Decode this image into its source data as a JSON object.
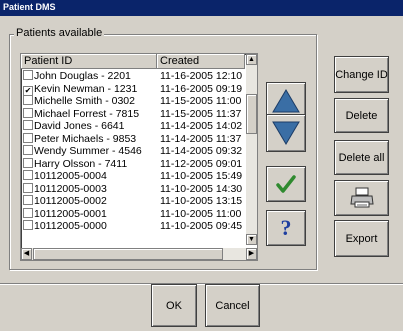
{
  "window": {
    "title": "Patient DMS"
  },
  "group": {
    "label": "Patients available"
  },
  "table": {
    "columns": [
      "Patient ID",
      "Created"
    ],
    "rows": [
      {
        "name": "John Douglas - 2201",
        "created": "11-16-2005 12:10",
        "checked": false
      },
      {
        "name": "Kevin Newman - 1231",
        "created": "11-16-2005 09:19",
        "checked": true
      },
      {
        "name": "Michelle Smith - 0302",
        "created": "11-15-2005 11:00",
        "checked": false
      },
      {
        "name": "Michael Forrest - 7815",
        "created": "11-15-2005 11:37",
        "checked": false
      },
      {
        "name": "David Jones - 6641",
        "created": "11-14-2005 14:02",
        "checked": false
      },
      {
        "name": "Peter Michaels - 9853",
        "created": "11-14-2005 11:37",
        "checked": false
      },
      {
        "name": "Wendy Summer - 4546",
        "created": "11-14-2005 09:32",
        "checked": false
      },
      {
        "name": "Harry Olsson - 7411",
        "created": "11-12-2005 09:01",
        "checked": false
      },
      {
        "name": "10112005-0004",
        "created": "11-10-2005 15:49",
        "checked": false
      },
      {
        "name": "10112005-0003",
        "created": "11-10-2005 14:30",
        "checked": false
      },
      {
        "name": "10112005-0002",
        "created": "11-10-2005 13:15",
        "checked": false
      },
      {
        "name": "10112005-0001",
        "created": "11-10-2005 11:00",
        "checked": false
      },
      {
        "name": "10112005-0000",
        "created": "11-10-2005 09:45",
        "checked": false
      }
    ]
  },
  "icons": {
    "up": "up-triangle-icon",
    "down": "down-triangle-icon",
    "check": "checkmark-icon",
    "help": "question-mark-icon",
    "printer": "printer-icon"
  },
  "buttons": {
    "change_id": "Change ID",
    "delete": "Delete",
    "delete_all": "Delete all",
    "export": "Export",
    "ok": "OK",
    "cancel": "Cancel"
  },
  "colors": {
    "titlebar": "#0a246a",
    "arrow": "#3a6ea5",
    "check": "#2f8a2f",
    "help": "#1f3fa0"
  }
}
